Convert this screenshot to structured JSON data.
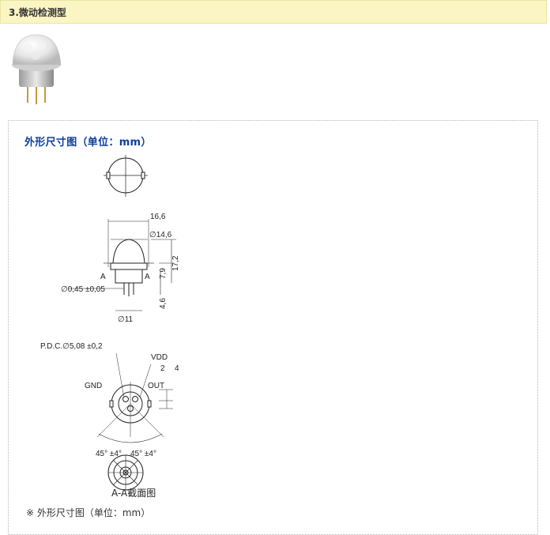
{
  "header": {
    "title": "3.微动检测型"
  },
  "section": {
    "title": "外形尺寸图（单位：mm）",
    "caption": "A-A截面图",
    "footnote": "※ 外形尺寸图（单位：mm）"
  },
  "dimensions": {
    "d1": "16,6",
    "d2": "∅14,6",
    "d3": "17,2",
    "d4": "7,9",
    "d5": "4,6",
    "d6": "∅11",
    "d7": "∅0,45 ±0,05",
    "sectionA_left": "A",
    "sectionA_right": "A",
    "pcd": "P.D.C.∅5,08 ±0,2",
    "vdd": "VDD",
    "gnd": "GND",
    "out": "OUT",
    "h2": "2",
    "h4": "4",
    "angle_left": "45° ±4°",
    "angle_right": "45° ±4°"
  }
}
